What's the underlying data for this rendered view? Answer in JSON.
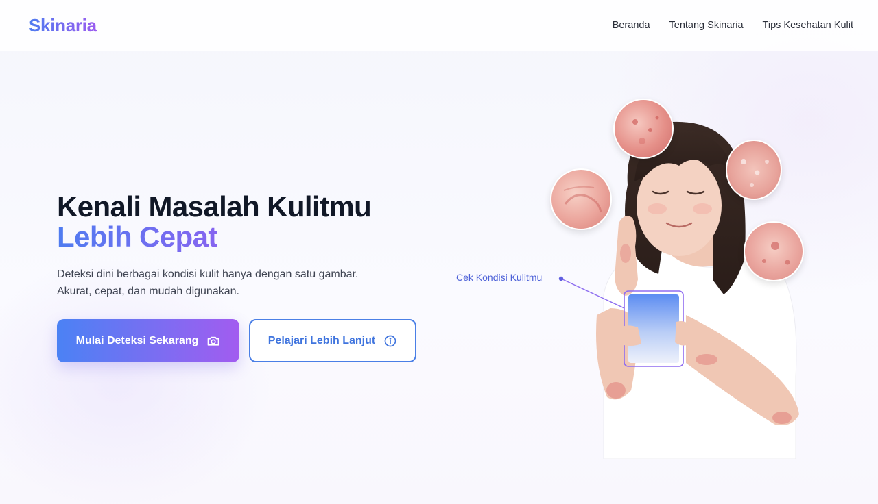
{
  "header": {
    "logo": "Skinaria",
    "nav": [
      {
        "label": "Beranda"
      },
      {
        "label": "Tentang Skinaria"
      },
      {
        "label": "Tips Kesehatan Kulit"
      }
    ]
  },
  "hero": {
    "title_line1": "Kenali Masalah Kulitmu",
    "title_line2": "Lebih Cepat",
    "description_line1": "Deteksi dini berbagai kondisi kulit hanya dengan satu gambar.",
    "description_line2": "Akurat, cepat, dan mudah digunakan.",
    "primary_button": {
      "label": "Mulai Deteksi Sekarang",
      "icon": "camera-icon"
    },
    "secondary_button": {
      "label": "Pelajari Lebih Lanjut",
      "icon": "info-icon"
    }
  },
  "illustration": {
    "callout": "Cek Kondisi Kulitmu"
  },
  "colors": {
    "brand_blue": "#4f7cf0",
    "brand_purple": "#9b5cf0",
    "text_dark": "#111827"
  }
}
